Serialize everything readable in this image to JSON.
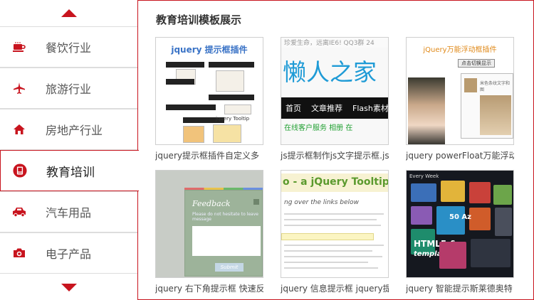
{
  "sidebar": {
    "items": [
      {
        "label": "餐饮行业",
        "icon": "coffee-cup-icon"
      },
      {
        "label": "旅游行业",
        "icon": "airplane-icon"
      },
      {
        "label": "房地产行业",
        "icon": "house-icon"
      },
      {
        "label": "教育培训",
        "icon": "book-icon"
      },
      {
        "label": "汽车用品",
        "icon": "car-icon"
      },
      {
        "label": "电子产品",
        "icon": "camera-icon"
      }
    ],
    "active_index": 3
  },
  "main": {
    "title": "教育培训模板展示",
    "cards": [
      {
        "caption": "jquery提示框插件自定义多"
      },
      {
        "caption": "js提示框制作js文字提示框.js"
      },
      {
        "caption": "jquery powerFloat万能浮动"
      },
      {
        "caption": "jquery 右下角提示框 快速反"
      },
      {
        "caption": "jquery 信息提示框 jquery提"
      },
      {
        "caption": "jquery 智能提示斯莱德奥特"
      }
    ]
  },
  "thumbs": {
    "t1_header": "jquery 提示框插件",
    "t1_small": "jquery Tooltip",
    "t2_topline": "珍爱生命，远离IE6!  QQ3群 24",
    "t2_big": "懒人之家",
    "t2_nav": [
      "首页",
      "文章推荐",
      "Flash素材"
    ],
    "t2_sub": "在线客户服务   相册   在",
    "t3_header": "jQuery万能浮动框插件",
    "t3_btn": "点击切换显示",
    "t3_panel_text": "米色条纹文字和图",
    "t4_title": "Feedback",
    "t4_small": "Please do not hesitate to leave message",
    "t4_submit": "Submit",
    "t5_header": "o - a jQuery Tooltip Pl",
    "t5_hover": "ng over the links below",
    "t6_header": "Every Week",
    "t6_text1": "HTML5 &",
    "t6_text2": "template",
    "t6_badge": "50 Az"
  },
  "colors": {
    "accent": "#c8141e",
    "border": "#dddddd",
    "t2_brand": "#1f9bd6"
  }
}
